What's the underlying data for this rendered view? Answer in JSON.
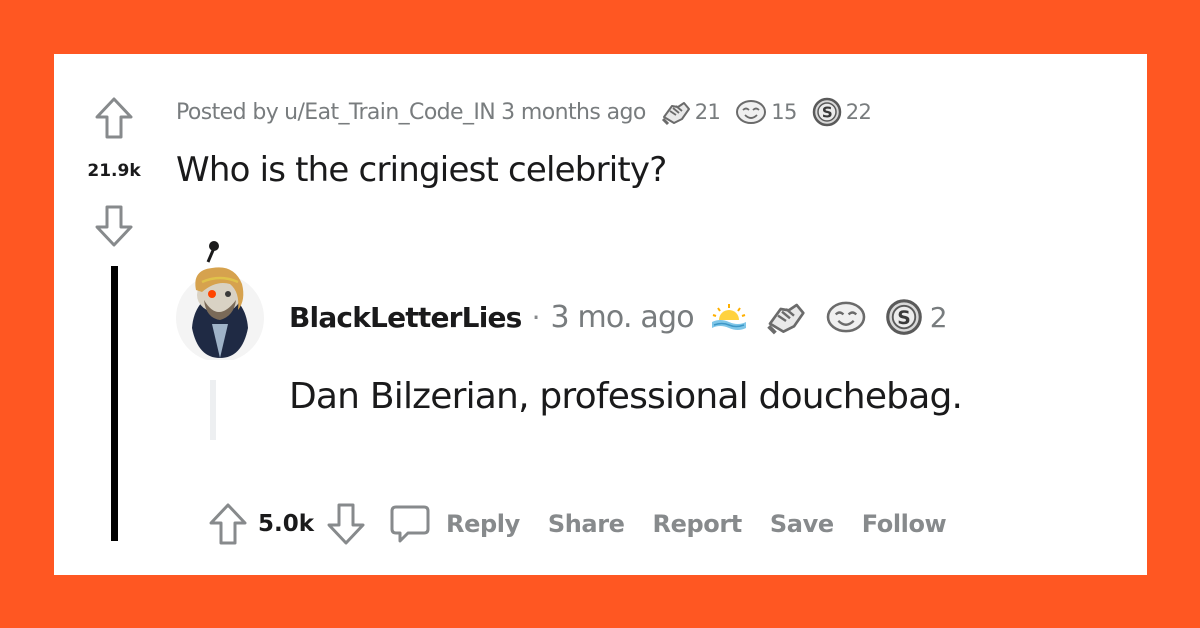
{
  "post": {
    "meta_prefix": "Posted by",
    "username": "u/Eat_Train_Code_IN",
    "time": "3 months ago",
    "awards": [
      {
        "icon": "handshake-award-icon",
        "count": "21"
      },
      {
        "icon": "wholesome-award-icon",
        "count": "15"
      },
      {
        "icon": "silver-award-icon",
        "count": "22"
      }
    ],
    "score": "21.9k",
    "title": "Who is the cringiest celebrity?"
  },
  "comment": {
    "author": "BlackLetterLies",
    "separator": "·",
    "time": "3 mo. ago",
    "awards": [
      {
        "icon": "sunrise-award-icon",
        "count": ""
      },
      {
        "icon": "handshake-award-icon",
        "count": ""
      },
      {
        "icon": "wholesome-award-icon",
        "count": ""
      },
      {
        "icon": "silver-award-icon",
        "count": "2"
      }
    ],
    "body": "Dan Bilzerian, professional douchebag.",
    "score": "5.0k",
    "actions": {
      "reply": "Reply",
      "share": "Share",
      "report": "Report",
      "save": "Save",
      "follow": "Follow"
    }
  },
  "colors": {
    "frame": "#ff5722",
    "card": "#ffffff",
    "text": "#1a1a1b",
    "meta": "#787c7e",
    "action": "#878a8c"
  }
}
